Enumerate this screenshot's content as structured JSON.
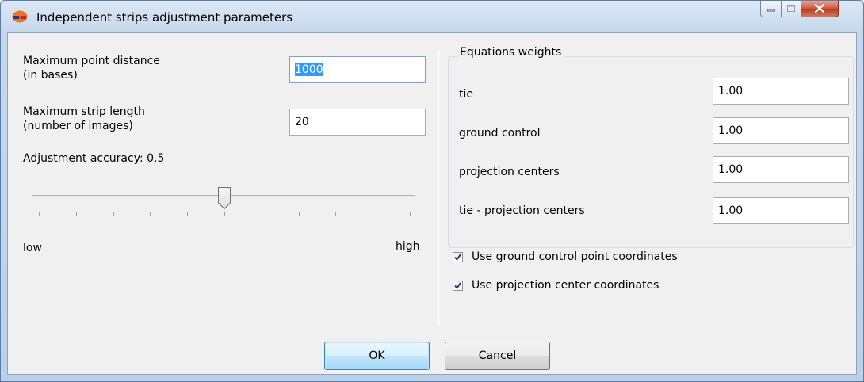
{
  "window": {
    "title": "Independent strips adjustment parameters",
    "icons": {
      "app": "stereo-glasses-icon",
      "minimize": "minimize-icon",
      "maximize": "maximize-icon",
      "close": "close-icon"
    }
  },
  "left": {
    "max_point_distance_label_line1": "Maximum point distance",
    "max_point_distance_label_line2": "(in bases)",
    "max_point_distance_value": "1000",
    "max_strip_length_label_line1": "Maximum strip length",
    "max_strip_length_label_line2": "(number of images)",
    "max_strip_length_value": "20",
    "accuracy_label": "Adjustment accuracy: 0.5",
    "accuracy_level": 0.5,
    "slider_low": "low",
    "slider_high": "high"
  },
  "weights": {
    "title": "Equations weights",
    "rows": [
      {
        "label": "tie",
        "value": "1.00"
      },
      {
        "label": "ground control",
        "value": "1.00"
      },
      {
        "label": "projection centers",
        "value": "1.00"
      },
      {
        "label": "tie - projection centers",
        "value": "1.00"
      }
    ]
  },
  "options": {
    "use_gcp_label": "Use ground control point coordinates",
    "use_gcp_checked": true,
    "use_projection_label": "Use projection center coordinates",
    "use_projection_checked": true
  },
  "buttons": {
    "ok": "OK",
    "cancel": "Cancel"
  },
  "colors": {
    "selection": "#3399ff",
    "default_button_border": "#3c7fb1"
  }
}
